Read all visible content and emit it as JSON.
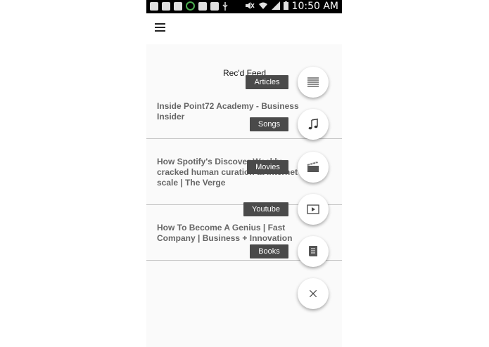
{
  "status_bar": {
    "time": "10:50 AM"
  },
  "app_bar": {
    "menu_icon": "hamburger-menu-icon"
  },
  "feed": {
    "title": "Rec'd Feed",
    "items": [
      {
        "text": "Inside Point72 Academy - Business Insider"
      },
      {
        "text": "How Spotify's Discover Weekly cracked human curation at internet scale | The Verge"
      },
      {
        "text": "How To Become A Genius | Fast Company | Business + Innovation"
      }
    ]
  },
  "speed_dial": {
    "actions": [
      {
        "label": "Articles",
        "icon": "articles-list-icon"
      },
      {
        "label": "Songs",
        "icon": "music-note-icon"
      },
      {
        "label": "Movies",
        "icon": "clapperboard-icon"
      },
      {
        "label": "Youtube",
        "icon": "play-video-icon"
      },
      {
        "label": "Books",
        "icon": "book-icon"
      }
    ],
    "close_icon": "close-icon"
  }
}
